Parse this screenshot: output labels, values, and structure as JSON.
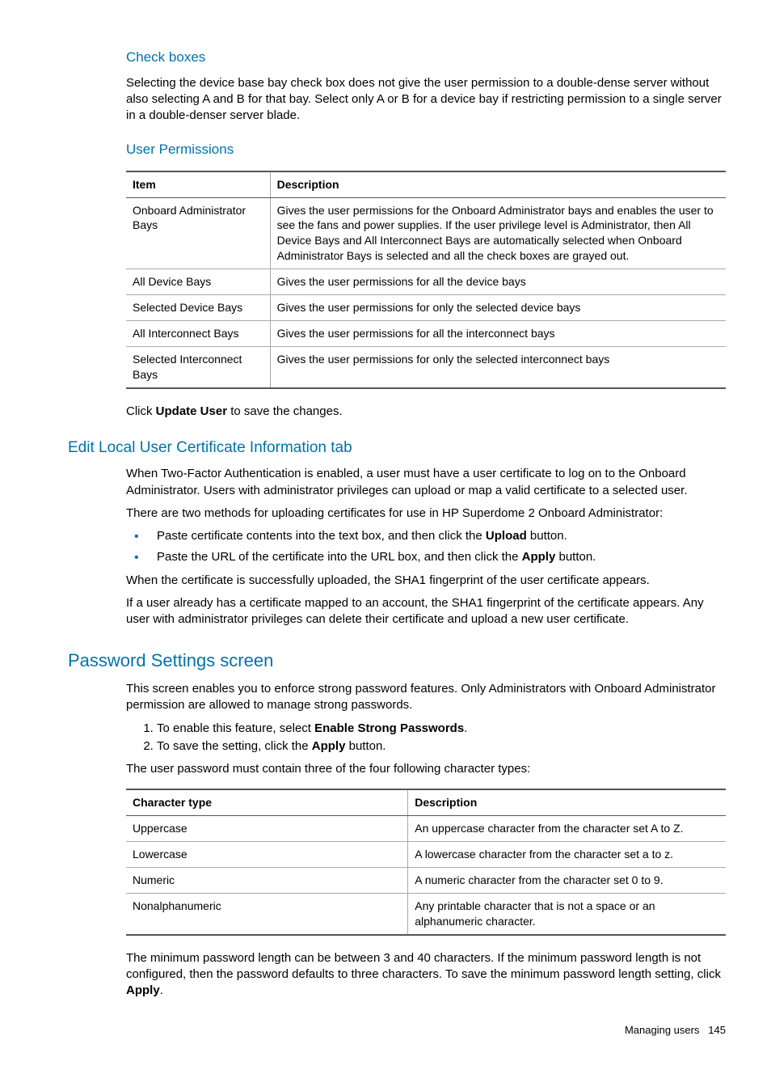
{
  "checkboxes": {
    "heading": "Check boxes",
    "para": "Selecting the device base bay check box does not give the user permission to a double-dense server without also selecting A and B for that bay. Select only A or B for a device bay if restricting permission to a single server in a double-denser server blade."
  },
  "userPermissions": {
    "heading": "User Permissions",
    "cols": {
      "item": "Item",
      "desc": "Description"
    },
    "rows": [
      {
        "item": "Onboard Administrator Bays",
        "desc": "Gives the user permissions for the Onboard Administrator bays and enables the user to see the fans and power supplies. If the user privilege level is Administrator, then All Device Bays and All Interconnect Bays are automatically selected when Onboard Administrator Bays is selected and all the check boxes are grayed out."
      },
      {
        "item": "All Device Bays",
        "desc": "Gives the user permissions for all the device bays"
      },
      {
        "item": "Selected Device Bays",
        "desc": "Gives the user permissions for only the selected device bays"
      },
      {
        "item": "All Interconnect Bays",
        "desc": "Gives the user permissions for all the interconnect bays"
      },
      {
        "item": "Selected Interconnect Bays",
        "desc": "Gives the user permissions for only the selected interconnect bays"
      }
    ],
    "afterTable": {
      "pre": "Click ",
      "bold": "Update User",
      "post": " to save the changes."
    }
  },
  "editCert": {
    "heading": "Edit Local User Certificate Information tab",
    "p1": "When Two-Factor Authentication is enabled, a user must have a user certificate to log on to the Onboard Administrator. Users with administrator privileges can upload or map a valid certificate to a selected user.",
    "p2": "There are two methods for uploading certificates for use in HP Superdome 2 Onboard Administrator:",
    "b1": {
      "pre": "Paste certificate contents into the text box, and then click the ",
      "bold": "Upload",
      "post": " button."
    },
    "b2": {
      "pre": "Paste the URL of the certificate into the URL box, and then click the ",
      "bold": "Apply",
      "post": " button."
    },
    "p3": "When the certificate is successfully uploaded, the SHA1 fingerprint of the user certificate appears.",
    "p4": "If a user already has a certificate mapped to an account, the SHA1 fingerprint of the certificate appears. Any user with administrator privileges can delete their certificate and upload a new user certificate."
  },
  "password": {
    "heading": "Password Settings screen",
    "p1": "This screen enables you to enforce strong password features. Only Administrators with Onboard Administrator permission are allowed to manage strong passwords.",
    "s1": {
      "pre": "To enable this feature, select ",
      "bold": "Enable Strong Passwords",
      "post": "."
    },
    "s2": {
      "pre": "To save the setting, click the ",
      "bold": "Apply",
      "post": " button."
    },
    "p2": "The user password must contain three of the four following character types:",
    "cols": {
      "type": "Character type",
      "desc": "Description"
    },
    "rows": [
      {
        "type": "Uppercase",
        "desc": "An uppercase character from the character set A to Z."
      },
      {
        "type": "Lowercase",
        "desc": "A lowercase character from the character set a to z."
      },
      {
        "type": "Numeric",
        "desc": "A numeric character from the character set 0 to 9."
      },
      {
        "type": "Nonalphanumeric",
        "desc": "Any printable character that is not a space or an alphanumeric character."
      }
    ],
    "p3": {
      "pre": "The minimum password length can be between 3 and 40 characters. If the minimum password length is not configured, then the password defaults to three characters. To save the minimum password length setting, click ",
      "bold": "Apply",
      "post": "."
    }
  },
  "footer": {
    "section": "Managing users",
    "page": "145"
  }
}
